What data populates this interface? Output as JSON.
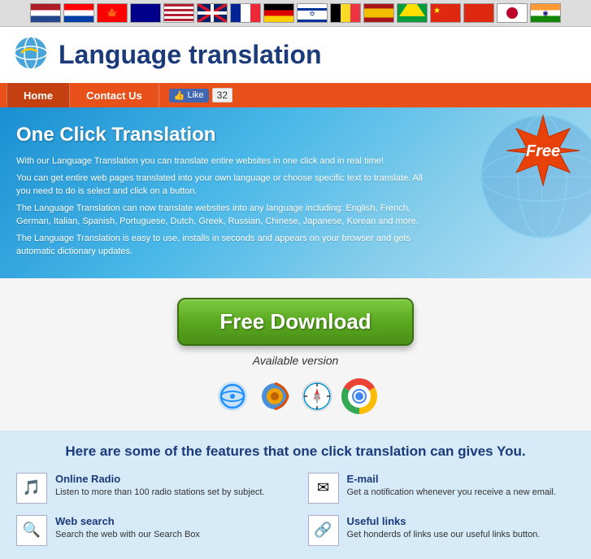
{
  "flagBar": {
    "flags": [
      {
        "id": "nl",
        "label": "Netherlands",
        "class": "flag-nl"
      },
      {
        "id": "nl2",
        "label": "Netherlands2",
        "class": "flag-nl2"
      },
      {
        "id": "ca",
        "label": "Canada",
        "class": "flag-ca"
      },
      {
        "id": "au",
        "label": "Australia",
        "class": "flag-au"
      },
      {
        "id": "us",
        "label": "United States",
        "class": "flag-us"
      },
      {
        "id": "gb",
        "label": "United Kingdom",
        "class": "flag-gb"
      },
      {
        "id": "fr",
        "label": "France",
        "class": "flag-fr"
      },
      {
        "id": "de",
        "label": "Germany",
        "class": "flag-de"
      },
      {
        "id": "il",
        "label": "Israel",
        "class": "flag-il"
      },
      {
        "id": "be",
        "label": "Belgium",
        "class": "flag-be"
      },
      {
        "id": "es",
        "label": "Spain",
        "class": "flag-es"
      },
      {
        "id": "br",
        "label": "Brazil",
        "class": "flag-br"
      },
      {
        "id": "cn",
        "label": "China",
        "class": "flag-cn"
      },
      {
        "id": "jp",
        "label": "Japan",
        "class": "flag-jp"
      },
      {
        "id": "in",
        "label": "India",
        "class": "flag-in"
      }
    ]
  },
  "header": {
    "title": "Language translation",
    "logo_alt": "Language translation logo"
  },
  "navbar": {
    "items": [
      {
        "label": "Home",
        "active": true
      },
      {
        "label": "Contact Us",
        "active": false
      }
    ],
    "like_label": "Like",
    "like_count": "32"
  },
  "hero": {
    "heading": "One Click Translation",
    "paragraph1": "With our Language Translation you can translate entire websites in one click and in real time!",
    "paragraph2": "You can get entire web pages translated into your own language or choose specific text to translate. All you need to do is select and click on a button.",
    "paragraph3": "The Language Translation can now translate websites into any language including: English, French, German, Italian, Spanish, Portuguese, Dutch, Greek, Russian, Chinese, Japanese, Korean and more.",
    "paragraph4": "The Language Translation is easy to use, installs in seconds and appears on your browser and gets automatic dictionary updates.",
    "free_badge": "Free"
  },
  "download": {
    "button_label": "Free Download",
    "available_version": "Available version",
    "browsers": [
      {
        "label": "Internet Explorer",
        "icon": "IE"
      },
      {
        "label": "Firefox",
        "icon": "FF"
      },
      {
        "label": "Safari",
        "icon": "SF"
      },
      {
        "label": "Chrome",
        "icon": "CH"
      }
    ]
  },
  "features": {
    "heading": "Here are some of the features that one click translation can gives You.",
    "items": [
      {
        "id": "online-radio",
        "title": "Online Radio",
        "description": "Listen to more than 100 radio stations set by subject.",
        "icon": "🎵"
      },
      {
        "id": "email",
        "title": "E-mail",
        "description": "Get a notification whenever you receive a new email.",
        "icon": "✉"
      },
      {
        "id": "web-search",
        "title": "Web search",
        "description": "Search the web with our Search Box",
        "icon": "🔍"
      },
      {
        "id": "useful-links",
        "title": "Useful links",
        "description": "Get honderds of links use our useful links button.",
        "icon": "🔗"
      }
    ]
  }
}
